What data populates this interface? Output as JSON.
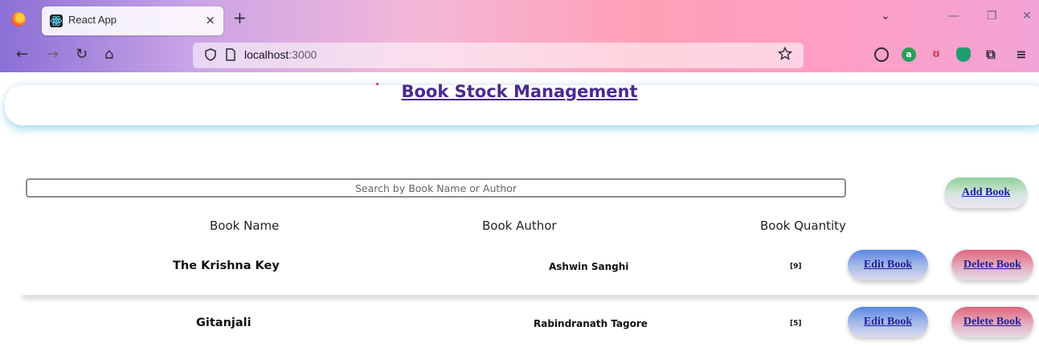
{
  "browser": {
    "tab_title": "React App",
    "tab_close": "×",
    "new_tab": "+",
    "url_host": "localhost",
    "url_port": ":3000",
    "tab_list_glyph": "⌄",
    "win_minimize": "—",
    "win_restore": "❐",
    "win_close": "✕",
    "nav": {
      "back": "←",
      "forward": "→",
      "reload": "↻",
      "home": "⌂"
    },
    "icons": [
      "firefox-icon",
      "react-favicon-icon",
      "shield-icon",
      "page-icon",
      "star-icon",
      "pocket-icon",
      "account-icon",
      "readlater-icon",
      "vpn-icon",
      "extensions-icon",
      "menu-icon"
    ]
  },
  "app": {
    "title": "Book Stock Management",
    "search_placeholder": "Search by Book Name or Author",
    "add_label": "Add Book",
    "columns": [
      "Book Name",
      "Book Author",
      "Book Quantity"
    ],
    "edit_label": "Edit Book",
    "delete_label": "Delete Book",
    "books": [
      {
        "name": "The Krishna Key",
        "author": "Ashwin Sanghi",
        "quantity": "[9]"
      },
      {
        "name": "Gitanjali",
        "author": "Rabindranath Tagore",
        "quantity": "[5]"
      }
    ]
  },
  "colors": {
    "title": "#4b2a8f",
    "link": "#1e1e9a",
    "add": "#8fcf9a",
    "edit": "#5b86e6",
    "delete": "#e0667e"
  }
}
